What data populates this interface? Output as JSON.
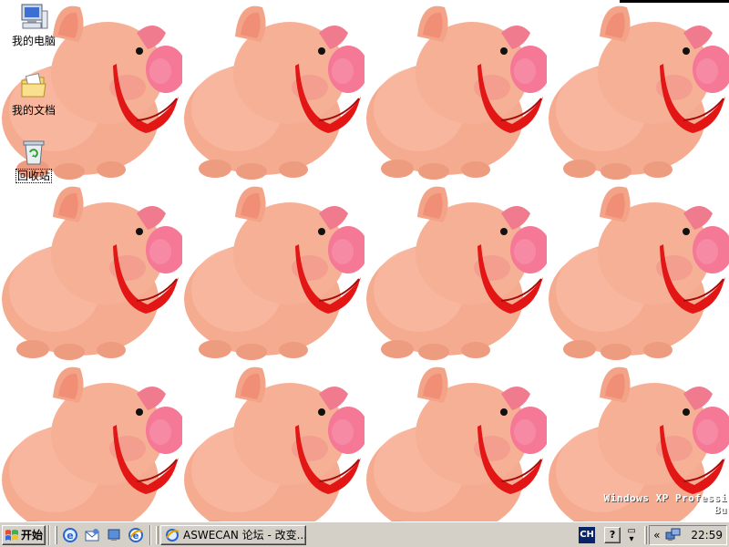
{
  "desktop": {
    "icons": [
      {
        "label": "我的电脑",
        "icon": "my-computer-icon"
      },
      {
        "label": "我的文档",
        "icon": "my-documents-icon"
      },
      {
        "label": "回收站",
        "icon": "recycle-bin-icon"
      }
    ],
    "watermark": {
      "line1": "Windows XP Professi",
      "line2": "Bu"
    }
  },
  "taskbar": {
    "start_label": "开始",
    "quick_launch": [
      "ie-icon",
      "outlook-icon",
      "show-desktop-icon",
      "ie-alt-icon"
    ],
    "task_button_label": "ASWECAN 论坛 - 改变...",
    "lang_indicator": "CH",
    "help_label": "?",
    "tray_chevron": "«",
    "clock": "22:59"
  },
  "colors": {
    "taskbar": "#d4d0c8",
    "pig_body": "#f4a98d",
    "pig_snout": "#f27a96",
    "pig_tongue": "#e51616"
  }
}
